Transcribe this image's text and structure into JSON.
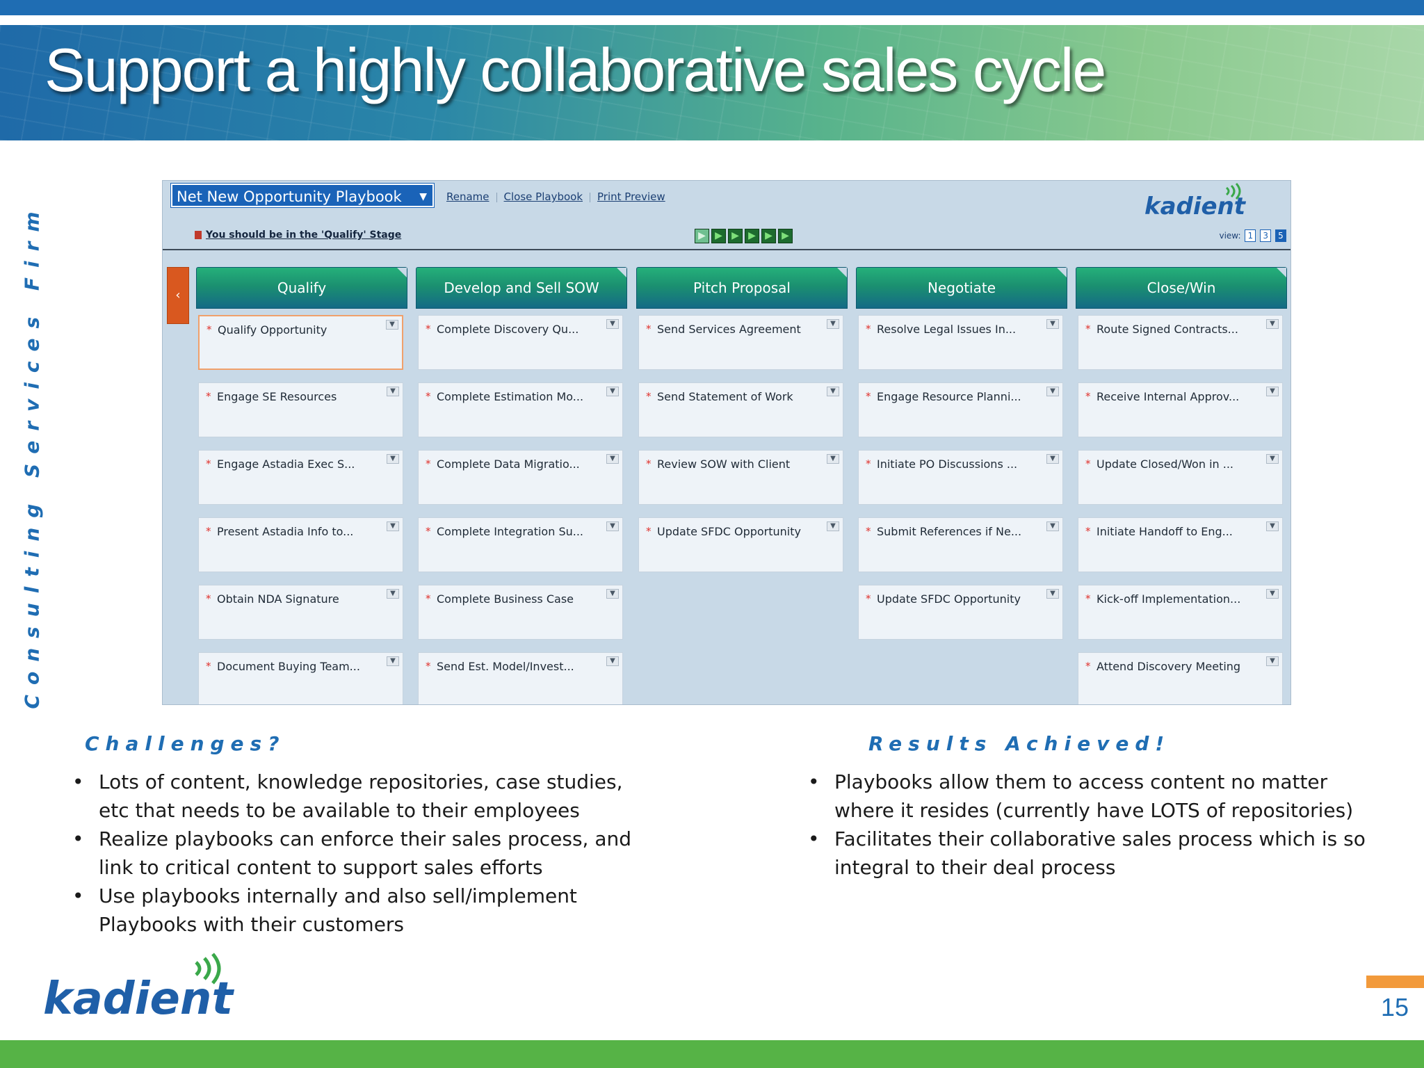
{
  "slide": {
    "title": "Support a highly collaborative sales cycle",
    "side_label": "Consulting Services Firm",
    "page_number": "15",
    "brand": "kadient"
  },
  "app": {
    "playbook_name": "Net New Opportunity Playbook",
    "links": [
      "Rename",
      "Close Playbook",
      "Print Preview"
    ],
    "stage_message": "You should be in the 'Qualify' Stage",
    "view_label": "view:",
    "view_options": [
      "1",
      "3",
      "5"
    ],
    "active_view": "5",
    "stages": [
      {
        "name": "Qualify",
        "tasks": [
          "Qualify Opportunity",
          "Engage SE Resources",
          "Engage Astadia Exec S...",
          "Present Astadia Info to...",
          "Obtain NDA Signature",
          "Document Buying Team..."
        ]
      },
      {
        "name": "Develop and Sell SOW",
        "tasks": [
          "Complete Discovery Qu...",
          "Complete Estimation Mo...",
          "Complete Data Migratio...",
          "Complete Integration Su...",
          "Complete Business Case",
          "Send Est. Model/Invest..."
        ]
      },
      {
        "name": "Pitch Proposal",
        "tasks": [
          "Send Services Agreement",
          "Send Statement of Work",
          "Review SOW with Client",
          "Update SFDC Opportunity"
        ]
      },
      {
        "name": "Negotiate",
        "tasks": [
          "Resolve Legal Issues In...",
          "Engage Resource Planni...",
          "Initiate PO Discussions ...",
          "Submit References if Ne...",
          "Update SFDC Opportunity"
        ]
      },
      {
        "name": "Close/Win",
        "tasks": [
          "Route Signed Contracts...",
          "Receive Internal Approv...",
          "Update Closed/Won in ...",
          "Initiate Handoff to Eng...",
          "Kick-off Implementation...",
          "Attend Discovery Meeting"
        ]
      }
    ]
  },
  "challenges": {
    "heading": "Challenges?",
    "items": [
      "Lots of content, knowledge repositories, case studies, etc that needs to be available to their employees",
      "Realize playbooks can enforce their sales process, and link to critical content to support sales efforts",
      "Use playbooks internally and also sell/implement Playbooks with their customers"
    ]
  },
  "results": {
    "heading": "Results Achieved!",
    "items": [
      "Playbooks allow them to access content no matter where it resides (currently have LOTS of repositories)",
      "Facilitates their collaborative sales process which is so integral to their deal process"
    ]
  },
  "colors": {
    "brand_blue": "#1f6db3",
    "brand_green": "#56b346",
    "accent_orange": "#f29a3b",
    "stage_header_green": "#1b9070",
    "required_star": "#e0322d"
  }
}
